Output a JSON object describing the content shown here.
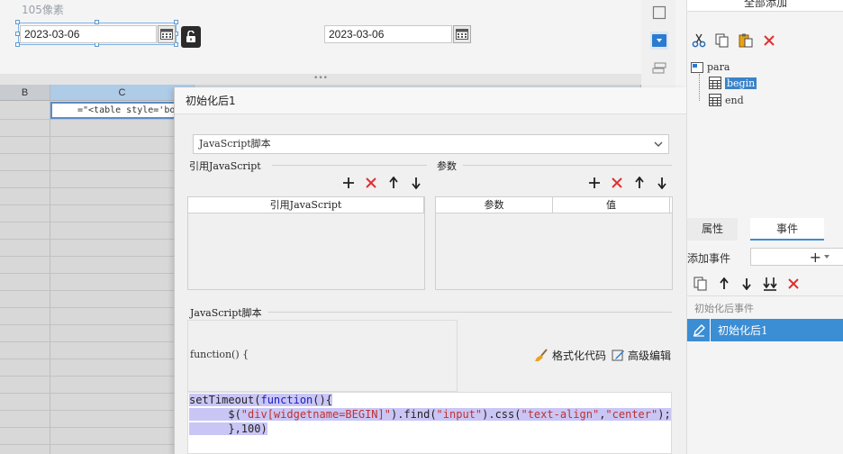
{
  "canvas": {
    "ruler_label": "105像素",
    "date_begin": "2023-03-06",
    "date_end": "2023-03-06",
    "divider_grip": "•••"
  },
  "sheet": {
    "columns": [
      "B",
      "C"
    ],
    "active_cell_text": "=\"<table style='bo"
  },
  "dialog": {
    "title": "初始化后1",
    "script_type": "JavaScript脚本",
    "ref_section_label": "引用JavaScript",
    "param_section_label": "参数",
    "ref_grid_header": "引用JavaScript",
    "param_grid_headers": [
      "参数",
      "值"
    ],
    "script_section_label": "JavaScript脚本",
    "func_signature": "function() {",
    "format_code_label": "格式化代码",
    "advanced_edit_label": "高级编辑",
    "code": {
      "line1": {
        "pre": "setTimeout(",
        "kw": "function",
        "post": "(){"
      },
      "line2": {
        "pre": "      $(",
        "s1": "\"div[widgetname=BEGIN]\"",
        "mid1": ").find(",
        "s2": "\"input\"",
        "mid2": ").css(",
        "s3": "\"text-align\"",
        "comma": ",",
        "s4": "\"center\"",
        "end": ");"
      },
      "line3": {
        "text": "      },100)"
      }
    }
  },
  "right_panel": {
    "add_all_label": "全部添加",
    "tree": {
      "root": "para",
      "children": [
        "begin",
        "end"
      ],
      "selected": "begin"
    },
    "tabs": [
      "属性",
      "事件"
    ],
    "active_tab": "事件",
    "add_event_label": "添加事件",
    "add_event_symbol": "+",
    "event_group_label": "初始化后事件",
    "event_item": "初始化后1"
  },
  "colors": {
    "accent": "#3b8dd4",
    "delete_red": "#e03030",
    "code_highlight": "#c9c6f5",
    "keyword": "#1b1bc2",
    "string": "#c03030"
  }
}
